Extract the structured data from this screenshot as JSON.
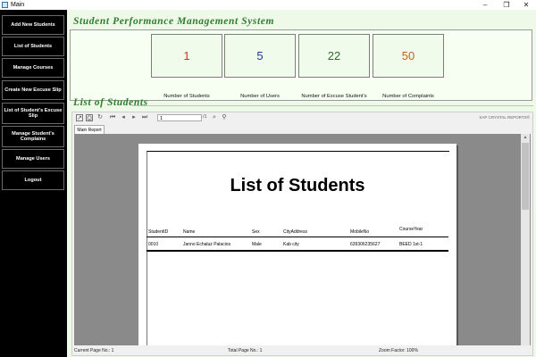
{
  "window": {
    "title": "Main",
    "minimize": "–",
    "maximize": "❐",
    "close": "✕"
  },
  "sidebar": {
    "items": [
      {
        "label": "Add New Students"
      },
      {
        "label": "List of Students"
      },
      {
        "label": "Manage Courses"
      },
      {
        "label": "Create New Excuse Slip"
      },
      {
        "label": "List of Student's Excuse Slip"
      },
      {
        "label": "Manage Student's Complains"
      },
      {
        "label": "Manage Users"
      },
      {
        "label": "Logout"
      }
    ]
  },
  "header": {
    "title": "Student Performance Management System"
  },
  "stats": [
    {
      "value": "1",
      "label": "Number of Students",
      "color": "#c0392b"
    },
    {
      "value": "5",
      "label": "Number of Users",
      "color": "#1f3a93"
    },
    {
      "value": "22",
      "label": "Number of Excuse Student's",
      "color": "#2f6b2f"
    },
    {
      "value": "50",
      "label": "Number of Complaints",
      "color": "#c0621b"
    }
  ],
  "list": {
    "title": "List of Students"
  },
  "viewer": {
    "brand": "SAP CRYSTAL REPORTS®",
    "page_input": "1",
    "page_of": "/1",
    "tab": "Main Report",
    "status": {
      "current_page": "Current Page No.: 1",
      "total_page": "Total Page No.: 1",
      "zoom": "Zoom Factor: 100%"
    }
  },
  "report": {
    "title": "List of Students",
    "columns": [
      "StudentID",
      "Name",
      "Sex",
      "CityAddress",
      "MobileNo",
      "CourseYear"
    ],
    "rows": [
      [
        "0010",
        "Janno Echaluz Palacios",
        "Male",
        "Kab city",
        "639306235627",
        "BEED 1st-1"
      ]
    ]
  }
}
